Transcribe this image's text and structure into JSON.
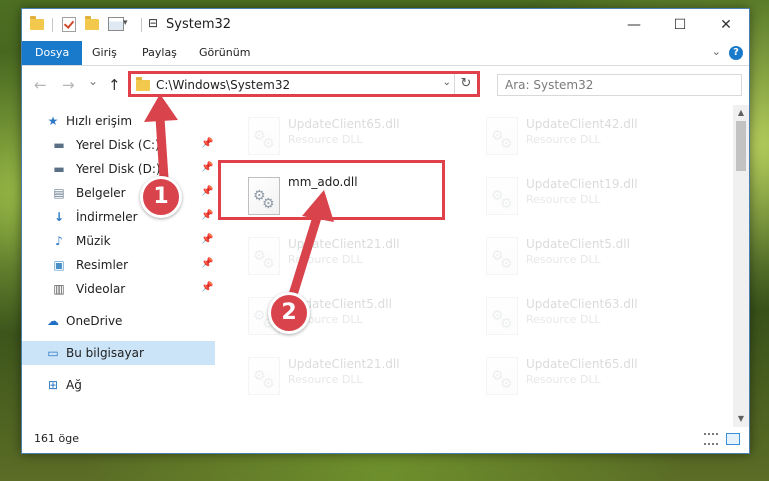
{
  "window": {
    "title": "System32",
    "min_glyph": "—",
    "max_glyph": "☐",
    "close_glyph": "✕"
  },
  "ribbon": {
    "tabs": [
      {
        "label": "Dosya",
        "active": true
      },
      {
        "label": "Giriş"
      },
      {
        "label": "Paylaş"
      },
      {
        "label": "Görünüm"
      }
    ],
    "help_glyph": "?"
  },
  "navbar": {
    "back_glyph": "←",
    "forward_glyph": "→",
    "recent_glyph": "⌄",
    "up_glyph": "↑",
    "address": "C:\\Windows\\System32",
    "dropdown_glyph": "⌄",
    "refresh_glyph": "↻",
    "search_placeholder": "Ara: System32"
  },
  "sidebar": {
    "items": [
      {
        "label": "Hızlı erişim",
        "icon": "star-icon",
        "pinned": false
      },
      {
        "label": "Yerel Disk (C:)",
        "icon": "drive-icon",
        "pinned": true
      },
      {
        "label": "Yerel Disk (D:)",
        "icon": "drive-icon",
        "pinned": true
      },
      {
        "label": "Belgeler",
        "icon": "document-icon",
        "pinned": true
      },
      {
        "label": "İndirmeler",
        "icon": "download-icon",
        "pinned": true
      },
      {
        "label": "Müzik",
        "icon": "music-icon",
        "pinned": true
      },
      {
        "label": "Resimler",
        "icon": "pictures-icon",
        "pinned": true
      },
      {
        "label": "Videolar",
        "icon": "video-icon",
        "pinned": true
      },
      {
        "label": "OneDrive",
        "icon": "cloud-icon",
        "pinned": false
      },
      {
        "label": "Bu bilgisayar",
        "icon": "computer-icon",
        "pinned": false,
        "selected": true
      },
      {
        "label": "Ağ",
        "icon": "network-icon",
        "pinned": false
      }
    ]
  },
  "files": [
    {
      "name": "UpdateClient65.dll",
      "type": "Resource DLL",
      "faded": true
    },
    {
      "name": "UpdateClient42.dll",
      "type": "Resource DLL",
      "faded": true
    },
    {
      "name": "mm_ado.dll",
      "type": "",
      "faded": false,
      "highlighted": true
    },
    {
      "name": "UpdateClient19.dll",
      "type": "Resource DLL",
      "faded": true
    },
    {
      "name": "UpdateClient21.dll",
      "type": "Resource DLL",
      "faded": true
    },
    {
      "name": "UpdateClient5.dll",
      "type": "Resource DLL",
      "faded": true
    },
    {
      "name": "UpdateClient5.dll",
      "type": "Resource DLL",
      "faded": true
    },
    {
      "name": "UpdateClient63.dll",
      "type": "Resource DLL",
      "faded": true
    },
    {
      "name": "UpdateClient21.dll",
      "type": "Resource DLL",
      "faded": true
    },
    {
      "name": "UpdateClient65.dll",
      "type": "Resource DLL",
      "faded": true
    }
  ],
  "status": {
    "item_count": "161 öge"
  },
  "markers": {
    "one": "1",
    "two": "2"
  },
  "colors": {
    "accent": "#1979ca",
    "marker": "#d9434b",
    "highlight_border": "#e0404a",
    "selected_bg": "#cce4f7"
  }
}
